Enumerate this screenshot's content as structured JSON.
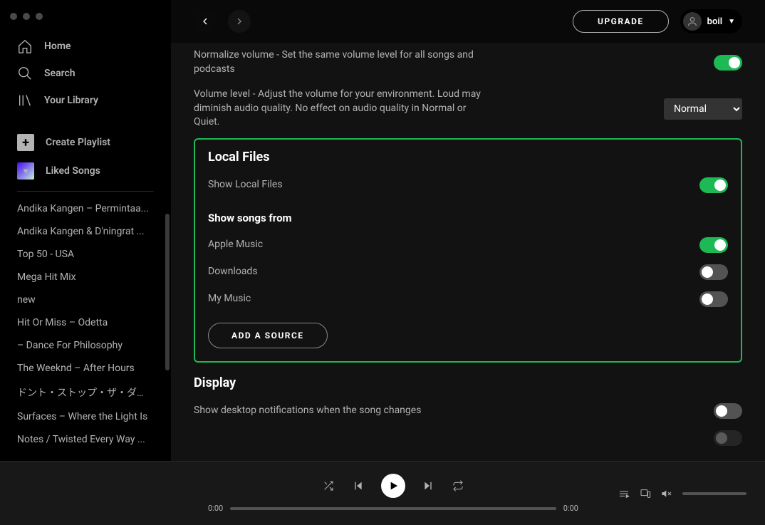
{
  "sidebar": {
    "nav": {
      "home": "Home",
      "search": "Search",
      "library": "Your Library"
    },
    "create_playlist": "Create Playlist",
    "liked_songs": "Liked Songs",
    "playlists": [
      "Andika Kangen – Permintaa...",
      "Andika Kangen & D'ningrat ...",
      "Top 50 - USA",
      "Mega Hit Mix",
      "new",
      "Hit Or Miss – Odetta",
      "– Dance For Philosophy",
      "The Weeknd – After Hours",
      "ドント・ストップ・ザ・ダン...",
      "Surfaces – Where the Light Is",
      "Notes / Twisted Every Way ..."
    ]
  },
  "topbar": {
    "upgrade": "UPGRADE",
    "username": "boil"
  },
  "settings": {
    "normalize_label": "Normalize volume - Set the same volume level for all songs and podcasts",
    "volume_level_label": "Volume level - Adjust the volume for your environment. Loud may diminish audio quality. No effect on audio quality in Normal or Quiet.",
    "volume_level_value": "Normal",
    "local_files": {
      "title": "Local Files",
      "show_local": "Show Local Files",
      "show_from_title": "Show songs from",
      "sources": [
        {
          "label": "Apple Music",
          "on": true
        },
        {
          "label": "Downloads",
          "on": false
        },
        {
          "label": "My Music",
          "on": false
        }
      ],
      "add_source": "ADD A SOURCE"
    },
    "display": {
      "title": "Display",
      "notifications": "Show desktop notifications when the song changes"
    }
  },
  "player": {
    "elapsed": "0:00",
    "total": "0:00"
  }
}
